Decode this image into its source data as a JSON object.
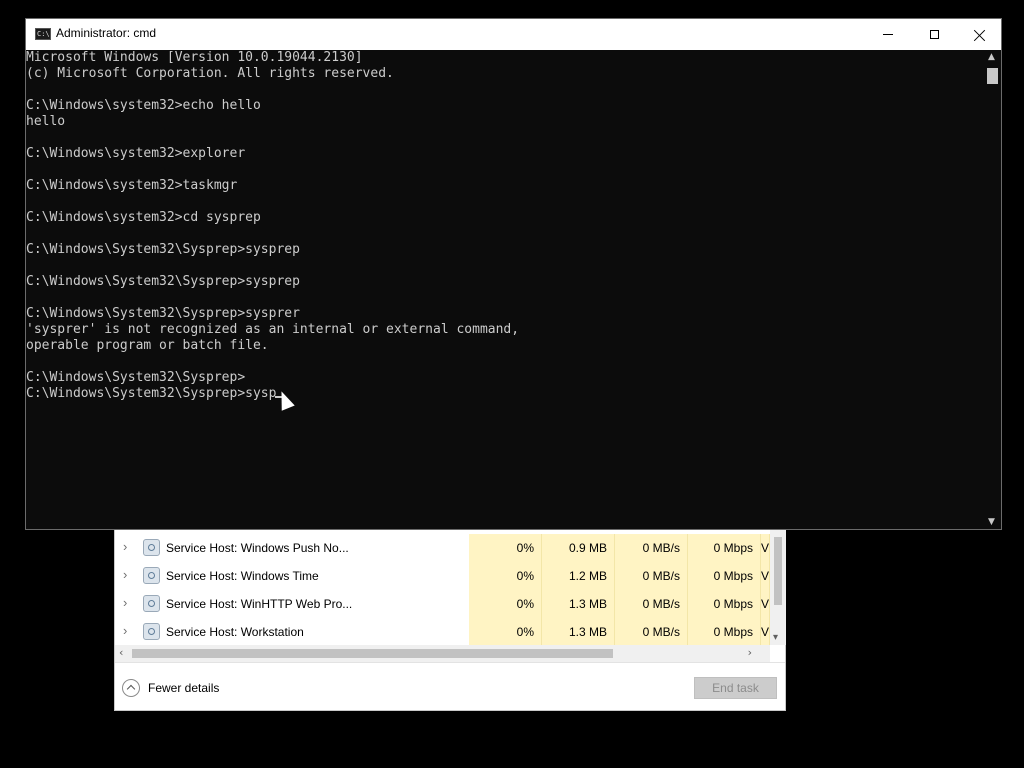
{
  "cmd_window": {
    "title": "Administrator: cmd",
    "app_icon_text": "C:\\",
    "lines": [
      "Microsoft Windows [Version 10.0.19044.2130]",
      "(c) Microsoft Corporation. All rights reserved.",
      "",
      "C:\\Windows\\system32>echo hello",
      "hello",
      "",
      "C:\\Windows\\system32>explorer",
      "",
      "C:\\Windows\\system32>taskmgr",
      "",
      "C:\\Windows\\system32>cd sysprep",
      "",
      "C:\\Windows\\System32\\Sysprep>sysprep",
      "",
      "C:\\Windows\\System32\\Sysprep>sysprep",
      "",
      "C:\\Windows\\System32\\Sysprep>sysprer",
      "'sysprer' is not recognized as an internal or external command,",
      "operable program or batch file.",
      "",
      "C:\\Windows\\System32\\Sysprep>"
    ],
    "current_input_line": "C:\\Windows\\System32\\Sysprep>sysp"
  },
  "task_manager": {
    "rows": [
      {
        "name": "Service Host: Windows Push No...",
        "cpu": "0%",
        "memory": "0.9 MB",
        "disk": "0 MB/s",
        "network": "0 Mbps",
        "more": "V"
      },
      {
        "name": "Service Host: Windows Time",
        "cpu": "0%",
        "memory": "1.2 MB",
        "disk": "0 MB/s",
        "network": "0 Mbps",
        "more": "V"
      },
      {
        "name": "Service Host: WinHTTP Web Pro...",
        "cpu": "0%",
        "memory": "1.3 MB",
        "disk": "0 MB/s",
        "network": "0 Mbps",
        "more": "V"
      },
      {
        "name": "Service Host: Workstation",
        "cpu": "0%",
        "memory": "1.3 MB",
        "disk": "0 MB/s",
        "network": "0 Mbps",
        "more": "V"
      }
    ],
    "fewer_details_label": "Fewer details",
    "end_task_label": "End task"
  }
}
